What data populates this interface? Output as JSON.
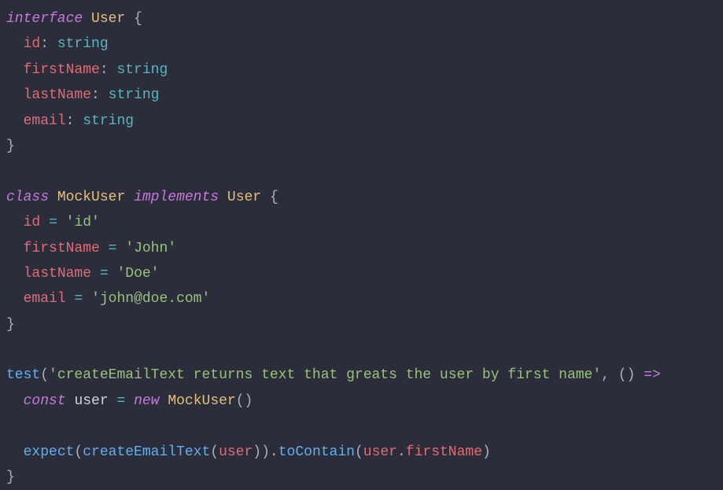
{
  "tokens": {
    "interface": "interface",
    "class": "class",
    "implements": "implements",
    "const": "const",
    "new": "new",
    "User": "User",
    "MockUser": "MockUser",
    "id": "id",
    "firstName": "firstName",
    "lastName": "lastName",
    "email": "email",
    "string": "string",
    "user": "user",
    "test": "test",
    "expect": "expect",
    "createEmailText": "createEmailText",
    "toContain": "toContain"
  },
  "strings": {
    "idVal": "'id'",
    "johnVal": "'John'",
    "doeVal": "'Doe'",
    "emailVal": "'john@doe.com'",
    "testDesc": "'createEmailText returns text that greats the user by first name'"
  },
  "punct": {
    "openBrace": "{",
    "closeBrace": "}",
    "colon": ":",
    "eq": "=",
    "openParen": "(",
    "closeParen": ")",
    "comma": ",",
    "dot": ".",
    "arrow": "=>",
    "emptyParens": "()"
  }
}
